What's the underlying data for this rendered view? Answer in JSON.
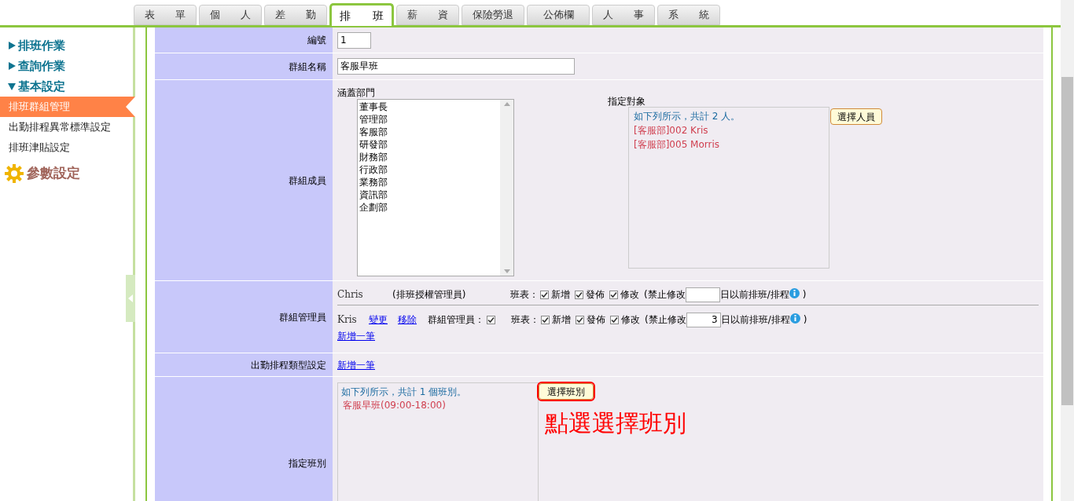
{
  "tabs": [
    {
      "label": "表　　單",
      "selected": false
    },
    {
      "label": "個　　人",
      "selected": false
    },
    {
      "label": "差　　勤",
      "selected": false
    },
    {
      "label": "排　　班",
      "selected": true
    },
    {
      "label": "薪　　資",
      "selected": false
    },
    {
      "label": "保險勞退",
      "selected": false
    },
    {
      "label": "公佈欄",
      "selected": false
    },
    {
      "label": "人　　事",
      "selected": false
    },
    {
      "label": "系　　統",
      "selected": false
    }
  ],
  "sidebar": {
    "items": [
      {
        "label": "排班作業",
        "expanded": false
      },
      {
        "label": "查詢作業",
        "expanded": false
      },
      {
        "label": "基本設定",
        "expanded": true,
        "children": [
          {
            "label": "排班群組管理",
            "selected": true
          },
          {
            "label": "出勤排程異常標準設定",
            "selected": false
          },
          {
            "label": "排班津貼設定",
            "selected": false
          }
        ]
      }
    ],
    "settings": "參數設定"
  },
  "form": {
    "number": {
      "label": "編號",
      "value": "1"
    },
    "group_name": {
      "label": "群組名稱",
      "value": "客服早班"
    },
    "members": {
      "label": "群組成員",
      "departments_label": "涵蓋部門",
      "departments": [
        "董事長",
        "管理部",
        "客服部",
        "研發部",
        "財務部",
        "行政部",
        "業務部",
        "資訊部",
        "企劃部"
      ],
      "assignees_label": "指定對象",
      "assignees_summary": "如下列所示，共計 2 人。",
      "assignees": [
        "[客服部]002 Kris",
        "[客服部]005 Morris"
      ],
      "select_button": "選擇人員"
    },
    "managers": {
      "label": "群組管理員",
      "rows": [
        {
          "name": "Chris",
          "role": "(排班授權管理員)",
          "schedule_label": "班表：",
          "perms": [
            {
              "label": "新增",
              "checked": true
            },
            {
              "label": "發佈",
              "checked": true
            },
            {
              "label": "修改",
              "checked": true
            }
          ],
          "lock_prefix": "(禁止修改",
          "lock_suffix": "日以前排班/排程",
          "close": ")"
        },
        {
          "name": "Kris",
          "links": [
            "變更",
            "移除"
          ],
          "group_admin": {
            "label": "群組管理員：",
            "checked": true
          },
          "schedule_label": "班表：",
          "perms": [
            {
              "label": "新增",
              "checked": true
            },
            {
              "label": "發佈",
              "checked": true
            },
            {
              "label": "修改",
              "checked": true
            }
          ],
          "lock_prefix": "(禁止修改",
          "lock_days": "3",
          "lock_suffix": "日以前排班/排程",
          "close": ")"
        }
      ],
      "add_link": "新增一筆"
    },
    "attendance_types": {
      "label": "出勤排程類型設定",
      "add_link": "新增一筆"
    },
    "shifts": {
      "label": "指定班別",
      "summary": "如下列所示，共計 1 個班別。",
      "items": [
        "客服早班(09:00-18:00)"
      ],
      "select_button": "選擇班別",
      "annotation": "點選選擇班別"
    }
  }
}
